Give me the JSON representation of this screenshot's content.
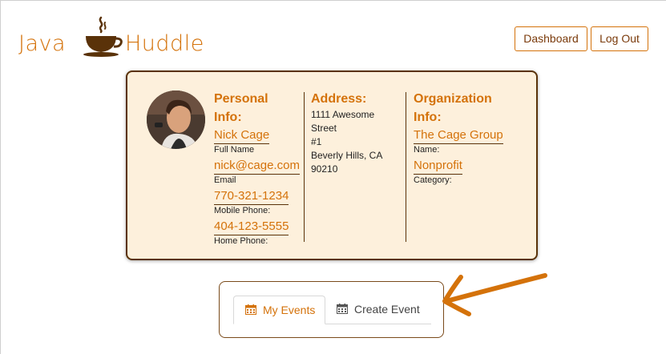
{
  "brand": {
    "word1": "Java",
    "word2": "Huddle"
  },
  "header": {
    "dashboard_label": "Dashboard",
    "logout_label": "Log Out"
  },
  "profile": {
    "personal": {
      "title": "Personal Info:",
      "full_name": "Nick Cage",
      "full_name_label": "Full Name",
      "email": "nick@cage.com",
      "email_label": "Email",
      "mobile_phone": "770-321-1234",
      "mobile_phone_label": "Mobile Phone:",
      "home_phone": "404-123-5555",
      "home_phone_label": "Home Phone:"
    },
    "address": {
      "title": "Address:",
      "line1": "1111 Awesome Street",
      "line2": "#1",
      "line3": "Beverly Hills, CA 90210"
    },
    "organization": {
      "title": "Organization Info:",
      "name": "The Cage Group",
      "name_label": "Name:",
      "category": "Nonprofit",
      "category_label": "Category:"
    }
  },
  "tabs": [
    {
      "label": "My Events",
      "icon": "calendar-icon",
      "active": true
    },
    {
      "label": "Create Event",
      "icon": "calendar-icon",
      "active": false
    }
  ],
  "colors": {
    "accent": "#d4720a",
    "brown": "#5a3209",
    "card_bg": "#fdf0dc"
  }
}
